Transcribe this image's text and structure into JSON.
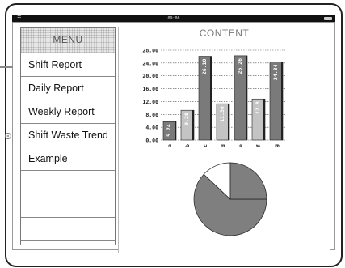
{
  "status_bar": {
    "time": "09:06"
  },
  "menu": {
    "header": "MENU",
    "items": [
      {
        "label": "Shift Report"
      },
      {
        "label": "Daily Report"
      },
      {
        "label": "Weekly Report"
      },
      {
        "label": "Shift Waste Trend"
      },
      {
        "label": "Example"
      },
      {
        "label": ""
      },
      {
        "label": ""
      },
      {
        "label": ""
      }
    ]
  },
  "content": {
    "title": "CONTENT"
  },
  "colors": {
    "bar_dark": "#7a7a7a",
    "bar_light": "#c4c4c4",
    "pie_dark": "#7f7f7f",
    "pie_light": "#ffffff"
  },
  "chart_data": [
    {
      "type": "bar",
      "categories": [
        "a",
        "b",
        "c",
        "d",
        "e",
        "f",
        "g"
      ],
      "values": [
        5.74,
        9.28,
        26.1,
        11.3,
        26.26,
        12.8,
        24.34
      ],
      "value_labels": [
        "5.74",
        "9.28",
        "26.10",
        "11.30",
        "26.26",
        "12.8",
        "24.34"
      ],
      "y_ticks": [
        "0.00",
        "4.00",
        "8.00",
        "12.00",
        "16.00",
        "20.00",
        "24.00",
        "28.00"
      ],
      "ylim": [
        0,
        28
      ],
      "grid": true,
      "title": "",
      "xlabel": "",
      "ylabel": ""
    },
    {
      "type": "pie",
      "values": [
        62,
        13,
        25
      ],
      "title": ""
    }
  ]
}
